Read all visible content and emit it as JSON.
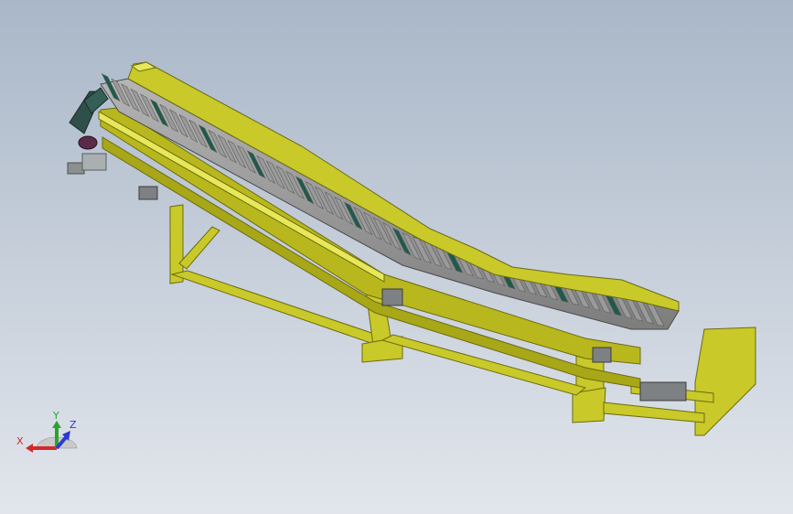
{
  "viewport": {
    "background_top": "#a9b7c8",
    "background_bottom": "#e2e6ec"
  },
  "model": {
    "frame_color": "#c9c92a",
    "frame_shadow": "#8f8f14",
    "frame_highlight": "#e7e75a",
    "slat_color": "#9a9a9a",
    "slat_shadow": "#5e5e5e",
    "cleat_color": "#1f5a4c",
    "motor_color": "#2f4f4a"
  },
  "triad": {
    "x_label": "X",
    "y_label": "Y",
    "z_label": "Z",
    "x_color": "#d22a2a",
    "y_color": "#2aa52a",
    "z_color": "#2a3ad2"
  }
}
